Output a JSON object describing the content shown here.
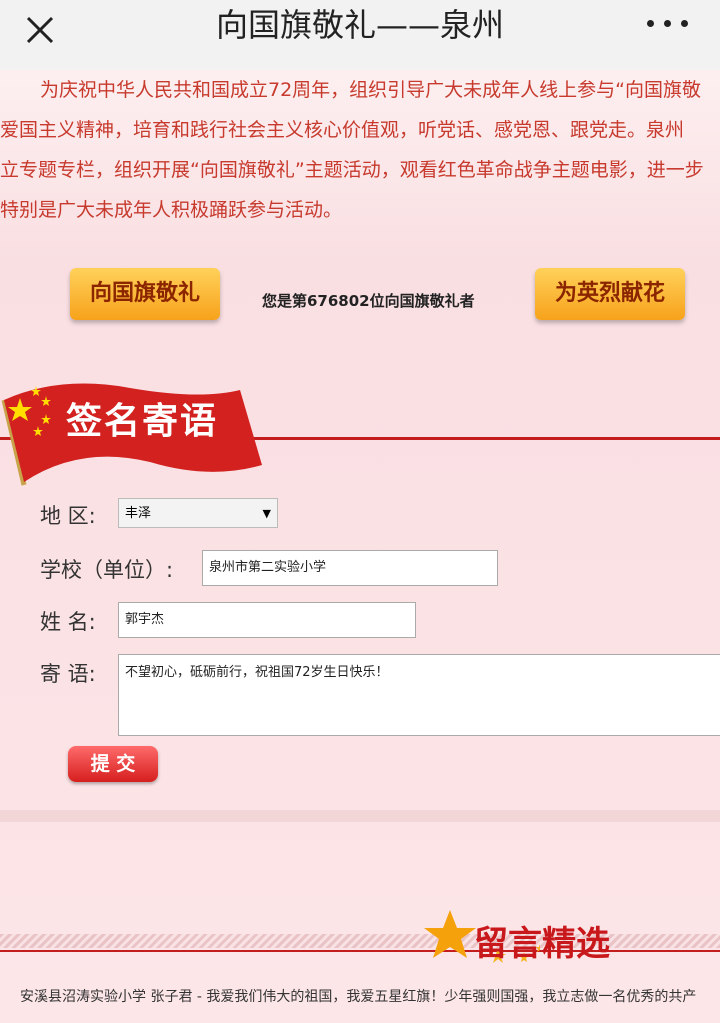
{
  "header": {
    "title": "向国旗敬礼——泉州",
    "close_icon": "close-icon",
    "more_icon": "more-icon"
  },
  "intro": {
    "lines": [
      "为庆祝中华人民共和国成立72周年，组织引导广大未成年人线上参与“向国旗敬",
      "爱国主义精神，培育和践行社会主义核心价值观，听党话、感党恩、跟党走。泉州",
      "立专题专栏，组织开展“向国旗敬礼”主题活动，观看红色革命战争主题电影，进一步",
      "特别是广大未成年人积极踊跃参与活动。"
    ]
  },
  "actions": {
    "salute_label": "向国旗敬礼",
    "counter_text": "您是第676802位向国旗敬礼者",
    "flower_label": "为英烈献花"
  },
  "sign_section": {
    "title": "签名寄语"
  },
  "form": {
    "region_label": "地  区:",
    "region_value": "丰泽",
    "school_label": "学校（单位）:",
    "school_value": "泉州市第二实验小学",
    "name_label": "姓  名:",
    "name_value": "郭宇杰",
    "message_label": "寄  语:",
    "message_value": "不望初心，砥砺前行，祝祖国72岁生日快乐！",
    "submit_label": "提 交"
  },
  "messages_section": {
    "title": "留言精选",
    "ticker": "安溪县沼涛实验小学 张子君    - 我爱我们伟大的祖国，我爱五星红旗！少年强则国强，我立志做一名优秀的共产"
  },
  "colors": {
    "accent_red": "#c31d1d",
    "intro_text": "#c73a2d",
    "orange_button": "#f7a21b"
  }
}
